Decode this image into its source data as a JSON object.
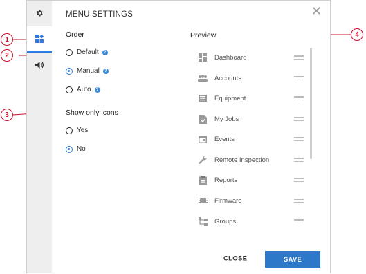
{
  "dialog": {
    "title": "MENU SETTINGS",
    "close_icon": "close-icon"
  },
  "sidebar": {
    "items": [
      {
        "icon": "gear-icon",
        "active": false
      },
      {
        "icon": "menu-layout-icon",
        "active": true
      },
      {
        "icon": "sound-icon",
        "active": false
      }
    ]
  },
  "order": {
    "label": "Order",
    "options": [
      {
        "label": "Default",
        "checked": false,
        "help": "?"
      },
      {
        "label": "Manual",
        "checked": true,
        "help": "?"
      },
      {
        "label": "Auto",
        "checked": false,
        "help": "?"
      }
    ]
  },
  "show_only_icons": {
    "label": "Show only icons",
    "options": [
      {
        "label": "Yes",
        "checked": false
      },
      {
        "label": "No",
        "checked": true
      }
    ]
  },
  "preview": {
    "label": "Preview",
    "items": [
      {
        "label": "Dashboard",
        "icon": "dashboard-icon"
      },
      {
        "label": "Accounts",
        "icon": "accounts-icon"
      },
      {
        "label": "Equipment",
        "icon": "equipment-icon"
      },
      {
        "label": "My Jobs",
        "icon": "jobs-icon"
      },
      {
        "label": "Events",
        "icon": "events-icon"
      },
      {
        "label": "Remote Inspection",
        "icon": "wrench-icon"
      },
      {
        "label": "Reports",
        "icon": "reports-icon"
      },
      {
        "label": "Firmware",
        "icon": "firmware-icon"
      },
      {
        "label": "Groups",
        "icon": "groups-icon"
      }
    ]
  },
  "footer": {
    "close_label": "CLOSE",
    "save_label": "SAVE"
  },
  "callouts": [
    "1",
    "2",
    "3",
    "4"
  ],
  "colors": {
    "accent": "#2c7be0",
    "save": "#2d78c8",
    "callout": "#c8102e"
  }
}
